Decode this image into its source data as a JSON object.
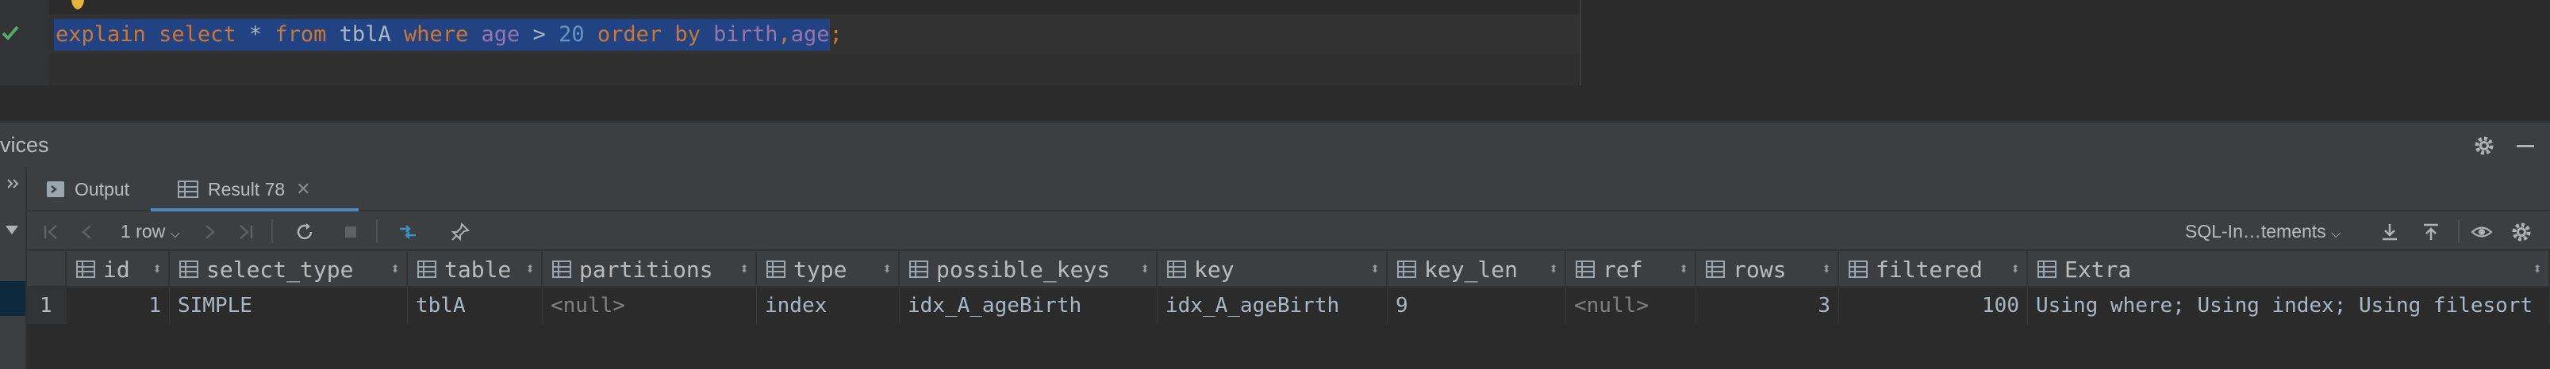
{
  "editor": {
    "tokens": [
      {
        "text": "explain",
        "cls": "kw"
      },
      {
        "text": " ",
        "cls": "id"
      },
      {
        "text": "select",
        "cls": "kw"
      },
      {
        "text": " * ",
        "cls": "id"
      },
      {
        "text": "from",
        "cls": "kw"
      },
      {
        "text": " tblA ",
        "cls": "id"
      },
      {
        "text": "where",
        "cls": "kw"
      },
      {
        "text": " ",
        "cls": "id"
      },
      {
        "text": "age",
        "cls": "col"
      },
      {
        "text": " > ",
        "cls": "id"
      },
      {
        "text": "20",
        "cls": "num"
      },
      {
        "text": " ",
        "cls": "id"
      },
      {
        "text": "order by",
        "cls": "kw"
      },
      {
        "text": " ",
        "cls": "id"
      },
      {
        "text": "birth",
        "cls": "col"
      },
      {
        "text": ",",
        "cls": "kw"
      },
      {
        "text": "age",
        "cls": "col"
      },
      {
        "text": ";",
        "cls": "kw"
      }
    ]
  },
  "services": {
    "title": "vices"
  },
  "tabs": {
    "output": "Output",
    "result": "Result 78"
  },
  "toolbar": {
    "row_count": "1 row",
    "mode": "SQL-In…tements"
  },
  "table": {
    "columns": [
      "id",
      "select_type",
      "table",
      "partitions",
      "type",
      "possible_keys",
      "key",
      "key_len",
      "ref",
      "rows",
      "filtered",
      "Extra"
    ],
    "rows": [
      {
        "num": "1",
        "cells": [
          "1",
          "SIMPLE",
          "tblA",
          "<null>",
          "index",
          "idx_A_ageBirth",
          "idx_A_ageBirth",
          "9",
          "<null>",
          "3",
          "100",
          "Using where; Using index; Using filesort"
        ]
      }
    ]
  },
  "colors": {
    "selection": "#214283",
    "keyword": "#cc7832",
    "accent": "#4a88c7"
  }
}
